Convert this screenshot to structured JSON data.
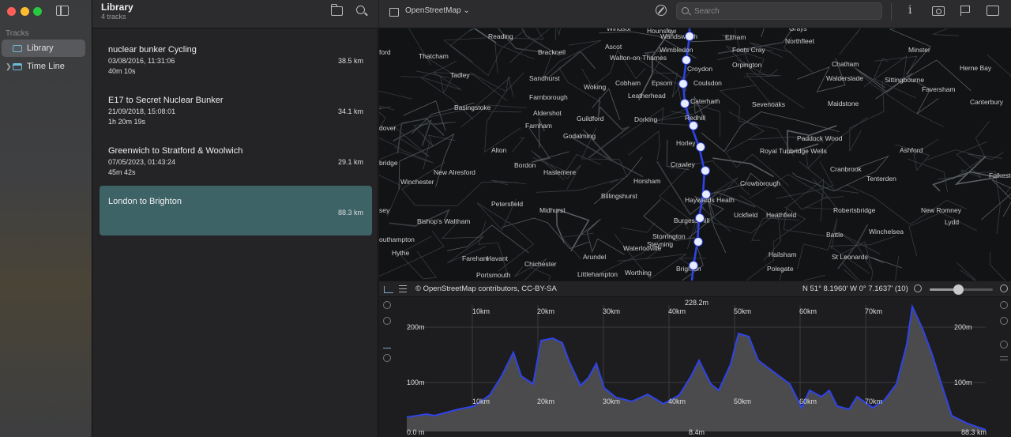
{
  "sidebar": {
    "section_label": "Tracks",
    "items": [
      {
        "label": "Library"
      },
      {
        "label": "Time Line"
      }
    ]
  },
  "list": {
    "title": "Library",
    "subtitle": "4 tracks",
    "tracks": [
      {
        "name": "nuclear bunker Cycling",
        "date": "03/08/2016, 11:31:06",
        "duration": "40m 10s",
        "distance": "38.5 km"
      },
      {
        "name": "E17 to Secret Nuclear Bunker",
        "date": "21/09/2018, 15:08:01",
        "duration": "1h 20m 19s",
        "distance": "34.1 km"
      },
      {
        "name": "Greenwich to Stratford & Woolwich",
        "date": "07/05/2023, 01:43:24",
        "duration": "45m 42s",
        "distance": "29.1 km"
      },
      {
        "name": "London to Brighton",
        "date": "",
        "duration": "",
        "distance": "88.3 km"
      }
    ],
    "selected_index": 3
  },
  "toolbar": {
    "map_source": "OpenStreetMap",
    "search_placeholder": "Search",
    "info_label": "i"
  },
  "map": {
    "cities": [
      "Windsor",
      "Hounslow",
      "Wandsworth",
      "Eltham",
      "Grays",
      "Reading",
      "Northfleet",
      "Bracknell",
      "Ascot",
      "Wimbledon",
      "Foots Cray",
      "Minster",
      "ford",
      "Thatcham",
      "Walton-on-Thames",
      "Croydon",
      "Orpington",
      "Chatham",
      "Herne Bay",
      "Tadley",
      "Sandhurst",
      "Cobham",
      "Epsom",
      "Coulsdon",
      "Walderslade",
      "Sittingbourne",
      "Woking",
      "Leatherhead",
      "Caterham",
      "Sevenoaks",
      "Maidstone",
      "Faversham",
      "Canterbury",
      "Basingstoke",
      "Farnborough",
      "Aldershot",
      "Guildford",
      "Dorking",
      "Redhill",
      "Farnham",
      "Paddock Wood",
      "dover",
      "Godalming",
      "Horley",
      "Royal Tunbridge Wells",
      "Ashford",
      "Alton",
      "Bordon",
      "Crawley",
      "Cranbrook",
      "bridge",
      "New Alresford",
      "Haslemere",
      "Folkestone",
      "Winchester",
      "Horsham",
      "Crowborough",
      "Tenterden",
      "Billingshurst",
      "Haywards Heath",
      "Petersfield",
      "Midhurst",
      "Burgess Hill",
      "Uckfield",
      "Heathfield",
      "Robertsbridge",
      "New Romney",
      "sey",
      "Bishop's Waltham",
      "Lydd",
      "Battle",
      "Winchelsea",
      "outhampton",
      "Storrington",
      "Steyning",
      "Hythe",
      "Waterlooville",
      "Hailsham",
      "St Leonards",
      "Fareham",
      "Havant",
      "Chichester",
      "Arundel",
      "Polegate",
      "Portsmouth",
      "Littlehampton",
      "Worthing",
      "Brighton"
    ],
    "attribution": "© OpenStreetMap contributors, CC-BY-SA",
    "coords": "N 51° 8.1960' W 0° 7.1637' (10)",
    "zoom_slider_fraction": 0.45
  },
  "elevation": {
    "max_label": "228.2m",
    "left_labels": [
      "200m",
      "100m"
    ],
    "right_labels": [
      "200m",
      "100m"
    ],
    "x_labels": [
      "10km",
      "20km",
      "30km",
      "40km",
      "50km",
      "60km",
      "70km"
    ],
    "bottom_left": "0.0 m",
    "bottom_mid": "8.4m",
    "bottom_right": "88.3 km"
  }
}
